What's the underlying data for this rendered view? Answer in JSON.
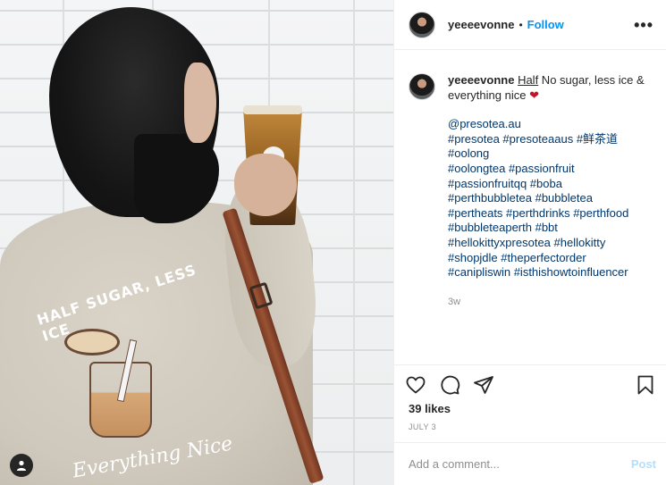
{
  "photo": {
    "print_title": "HALF SUGAR, LESS ICE",
    "print_footer": "Everything Nice"
  },
  "post_header": {
    "username": "yeeeevonne",
    "separator": "•",
    "follow_label": "Follow",
    "more_icon": "more-horizontal-icon"
  },
  "caption": {
    "username": "yeeeevonne",
    "half_word": "Half",
    "text": " No sugar, less ice & everything nice ",
    "emoji": "❤",
    "mention": "@presotea.au",
    "tag_lines": [
      "#presotea #presoteaaus #鲜茶道",
      "#oolong",
      "#oolongtea #passionfruit",
      "#passionfruitqq #boba",
      "#perthbubbletea #bubbletea",
      "#pertheats #perthdrinks #perthfood",
      "#bubbleteaperth #bbt",
      "#hellokittyxpresotea #hellokitty",
      "#shopjdle #theperfectorder",
      "#canipliswin #isthishowtoinfluencer"
    ],
    "time_ago": "3w"
  },
  "actions": {
    "like_icon": "heart-outline-icon",
    "comment_icon": "comment-bubble-icon",
    "share_icon": "paper-plane-icon",
    "save_icon": "bookmark-icon"
  },
  "likes_text": "39 likes",
  "date_text": "JULY 3",
  "comment": {
    "placeholder": "Add a comment...",
    "post_label": "Post"
  },
  "colors": {
    "accent_blue": "#0095f6",
    "post_disabled": "#b2dffc",
    "hashtag": "#00376b",
    "text": "#262626",
    "muted": "#8e8e8e",
    "heart": "#c0142b"
  }
}
